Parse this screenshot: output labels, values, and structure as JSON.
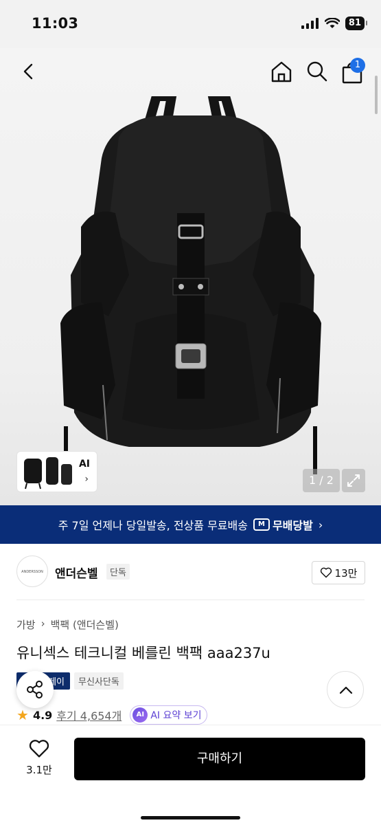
{
  "status_bar": {
    "time": "11:03",
    "battery": "81"
  },
  "product_image": {
    "pager": "1 / 2",
    "thumb_label": "AI"
  },
  "header": {
    "cart_count": "1"
  },
  "delivery_banner": {
    "text": "주 7일 언제나 당일발송, 전상품 무료배송",
    "brand": "무배당발",
    "logo": "M"
  },
  "brand": {
    "name": "앤더슨벨",
    "tag": "단독",
    "likes": "13만",
    "logo_text": "ANDERSSON BELL"
  },
  "breadcrumb": {
    "category": "가방",
    "subcategory": "백팩 (앤더슨벨)"
  },
  "product": {
    "title": "유니섹스 테크니컬 베를린 백팩 aaa237u",
    "tags": [
      "페이",
      "무신사단독"
    ],
    "rating": "4.9",
    "reviews": "후기 4,654개",
    "ai_summary": "AI 요약 보기",
    "ai_badge": "AI"
  },
  "bottom_bar": {
    "fav_count": "3.1만",
    "buy_label": "구매하기"
  },
  "colors": {
    "banner": "#0a2d78",
    "badge": "#1e6fe6",
    "star": "#f3a51c",
    "ai": "#5b3fd3"
  }
}
